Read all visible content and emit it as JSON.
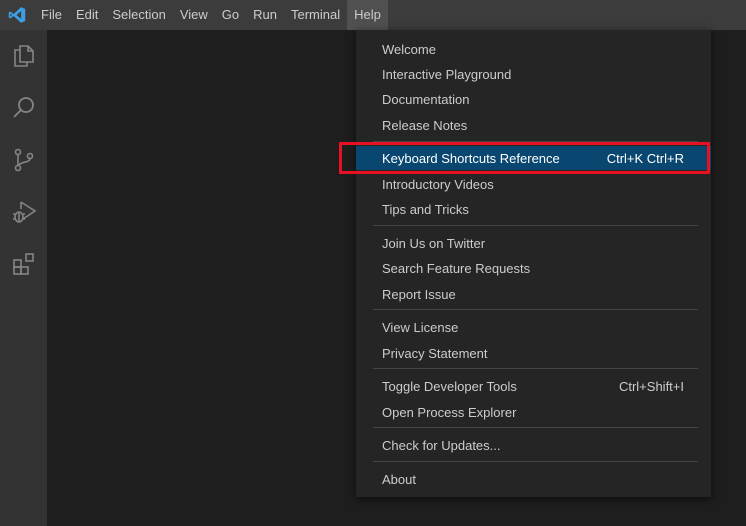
{
  "menubar": {
    "items": [
      "File",
      "Edit",
      "Selection",
      "View",
      "Go",
      "Run",
      "Terminal",
      "Help"
    ]
  },
  "activity_bar": {
    "icons": [
      "files-icon",
      "search-icon",
      "source-control-icon",
      "run-debug-icon",
      "extensions-icon"
    ]
  },
  "help_menu": {
    "items": [
      {
        "label": "Welcome",
        "shortcut": ""
      },
      {
        "label": "Interactive Playground",
        "shortcut": ""
      },
      {
        "label": "Documentation",
        "shortcut": ""
      },
      {
        "label": "Release Notes",
        "shortcut": ""
      },
      {
        "label": "Keyboard Shortcuts Reference",
        "shortcut": "Ctrl+K Ctrl+R"
      },
      {
        "label": "Introductory Videos",
        "shortcut": ""
      },
      {
        "label": "Tips and Tricks",
        "shortcut": ""
      },
      {
        "label": "Join Us on Twitter",
        "shortcut": ""
      },
      {
        "label": "Search Feature Requests",
        "shortcut": ""
      },
      {
        "label": "Report Issue",
        "shortcut": ""
      },
      {
        "label": "View License",
        "shortcut": ""
      },
      {
        "label": "Privacy Statement",
        "shortcut": ""
      },
      {
        "label": "Toggle Developer Tools",
        "shortcut": "Ctrl+Shift+I"
      },
      {
        "label": "Open Process Explorer",
        "shortcut": ""
      },
      {
        "label": "Check for Updates...",
        "shortcut": ""
      },
      {
        "label": "About",
        "shortcut": ""
      }
    ]
  },
  "colors": {
    "titlebar": "#3c3c3c",
    "activity_bar": "#333333",
    "editor": "#1e1e1e",
    "menu_bg": "#252526",
    "selected_item": "#094771",
    "highlight_border": "#e81123",
    "logo": "#3c9ee3"
  }
}
